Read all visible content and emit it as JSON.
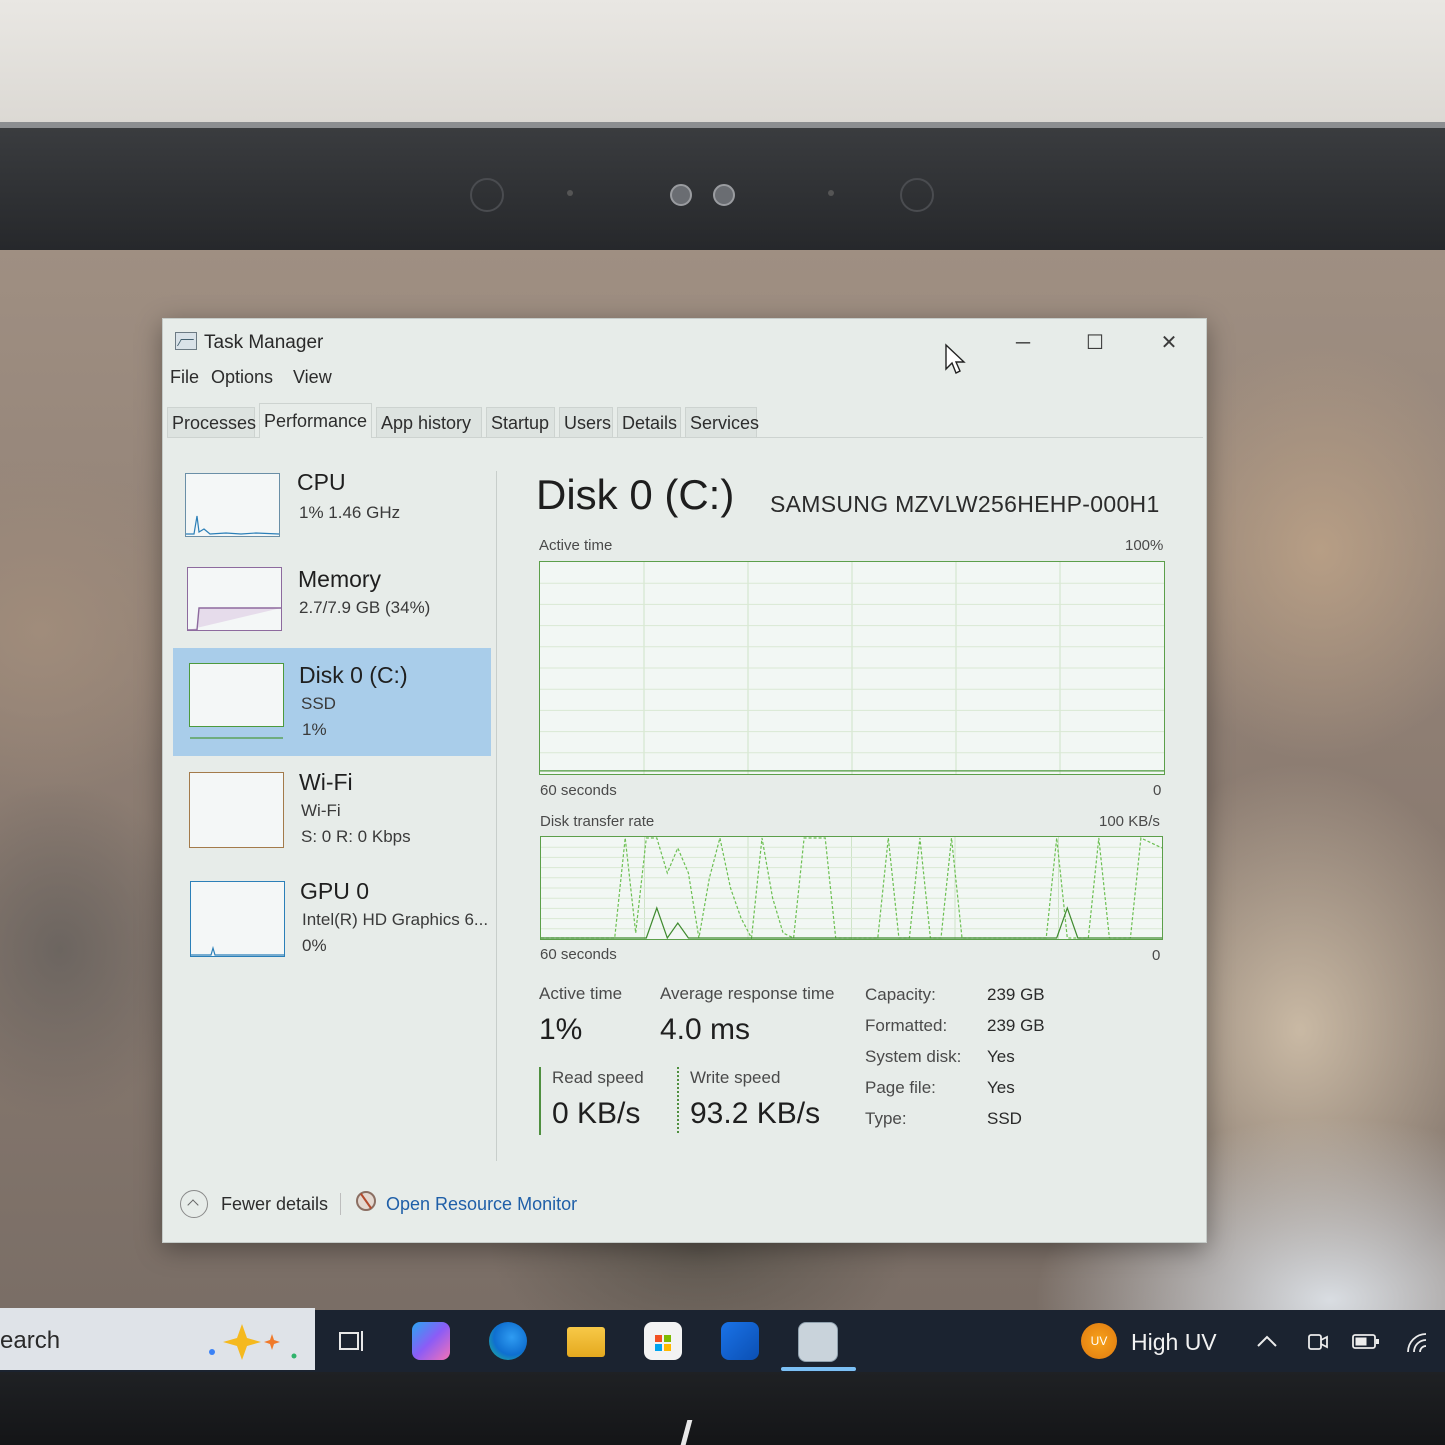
{
  "window": {
    "title": "Task Manager",
    "controls": {
      "minimize": "─",
      "maximize": "☐",
      "close": "✕"
    }
  },
  "menu": [
    "File",
    "Options",
    "View"
  ],
  "tabs": [
    "Processes",
    "Performance",
    "App history",
    "Startup",
    "Users",
    "Details",
    "Services"
  ],
  "active_tab": "Performance",
  "sidebar": {
    "items": [
      {
        "name": "CPU",
        "sub1": "1%  1.46 GHz",
        "sub2": ""
      },
      {
        "name": "Memory",
        "sub1": "2.7/7.9 GB (34%)",
        "sub2": ""
      },
      {
        "name": "Disk 0 (C:)",
        "sub1": "SSD",
        "sub2": "1%"
      },
      {
        "name": "Wi-Fi",
        "sub1": "Wi-Fi",
        "sub2": "S: 0  R: 0 Kbps"
      },
      {
        "name": "GPU 0",
        "sub1": "Intel(R) HD Graphics 6...",
        "sub2": "0%"
      }
    ],
    "selected_index": 2
  },
  "disk": {
    "title": "Disk 0 (C:)",
    "model": "SAMSUNG MZVLW256HEHP-000H1",
    "active_chart": {
      "label": "Active time",
      "max_label": "100%",
      "time_label": "60 seconds",
      "min_label": "0",
      "values": [
        1,
        1,
        1,
        1,
        1,
        1,
        1,
        1,
        1,
        1,
        1,
        1,
        1,
        1,
        1,
        1,
        1,
        1,
        1,
        1,
        1,
        1,
        1,
        1,
        1,
        1,
        1,
        1,
        1,
        1,
        1,
        1,
        1,
        1,
        1,
        1,
        1,
        1,
        1,
        1,
        1,
        1,
        1,
        1,
        1,
        1,
        1,
        1,
        1,
        1,
        1,
        1,
        1,
        1,
        1,
        1,
        1,
        1,
        1,
        1
      ]
    },
    "transfer_chart": {
      "label": "Disk transfer rate",
      "max_label": "100 KB/s",
      "time_label": "60 seconds",
      "min_label": "0",
      "write_values": [
        0,
        0,
        0,
        0,
        0,
        0,
        0,
        0,
        100,
        5,
        100,
        100,
        65,
        90,
        65,
        0,
        60,
        100,
        50,
        20,
        0,
        100,
        40,
        5,
        0,
        100,
        100,
        100,
        0,
        0,
        0,
        0,
        0,
        100,
        0,
        0,
        100,
        0,
        0,
        100,
        0,
        0,
        0,
        0,
        0,
        0,
        0,
        0,
        0,
        100,
        0,
        0,
        0,
        100,
        0,
        0,
        0,
        100,
        95,
        90
      ],
      "read_values": [
        0,
        0,
        0,
        0,
        0,
        0,
        0,
        0,
        0,
        0,
        0,
        30,
        0,
        15,
        0,
        0,
        0,
        0,
        0,
        0,
        0,
        0,
        0,
        0,
        0,
        0,
        0,
        0,
        0,
        0,
        0,
        0,
        0,
        0,
        0,
        0,
        0,
        0,
        0,
        0,
        0,
        0,
        0,
        0,
        0,
        0,
        0,
        0,
        0,
        0,
        30,
        0,
        0,
        0,
        0,
        0,
        0,
        0,
        0,
        0
      ]
    },
    "stats": {
      "active_time_label": "Active time",
      "active_time_value": "1%",
      "avg_response_label": "Average response time",
      "avg_response_value": "4.0 ms",
      "read_speed_label": "Read speed",
      "read_speed_value": "0 KB/s",
      "write_speed_label": "Write speed",
      "write_speed_value": "93.2 KB/s"
    },
    "properties": [
      {
        "key": "Capacity:",
        "value": "239 GB"
      },
      {
        "key": "Formatted:",
        "value": "239 GB"
      },
      {
        "key": "System disk:",
        "value": "Yes"
      },
      {
        "key": "Page file:",
        "value": "Yes"
      },
      {
        "key": "Type:",
        "value": "SSD"
      }
    ]
  },
  "footer": {
    "fewer_details": "Fewer details",
    "open_resource_monitor": "Open Resource Monitor"
  },
  "taskbar": {
    "search_text": "earch",
    "weather_badge": "UV",
    "weather_text": "High UV",
    "colors": {
      "taskbar": "#1b2330",
      "accent": "#7cc0f5",
      "selection": "#a9cdea",
      "graph_line": "#5c9f4a"
    }
  }
}
